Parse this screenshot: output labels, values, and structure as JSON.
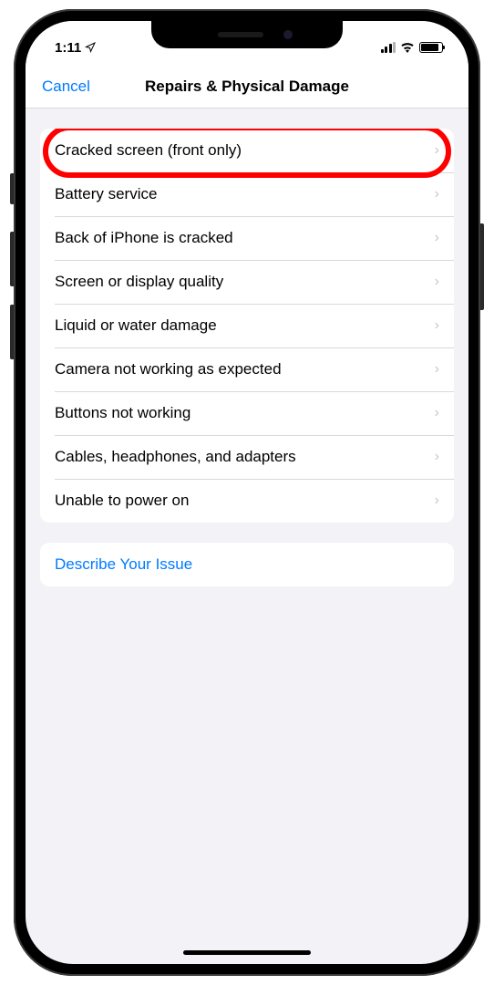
{
  "status": {
    "time": "1:11"
  },
  "nav": {
    "cancel": "Cancel",
    "title": "Repairs & Physical Damage"
  },
  "items": [
    {
      "label": "Cracked screen (front only)",
      "highlighted": true
    },
    {
      "label": "Battery service"
    },
    {
      "label": "Back of iPhone is cracked"
    },
    {
      "label": "Screen or display quality"
    },
    {
      "label": "Liquid or water damage"
    },
    {
      "label": "Camera not working as expected"
    },
    {
      "label": "Buttons not working"
    },
    {
      "label": "Cables, headphones, and adapters"
    },
    {
      "label": "Unable to power on"
    }
  ],
  "secondary": {
    "describe": "Describe Your Issue"
  }
}
